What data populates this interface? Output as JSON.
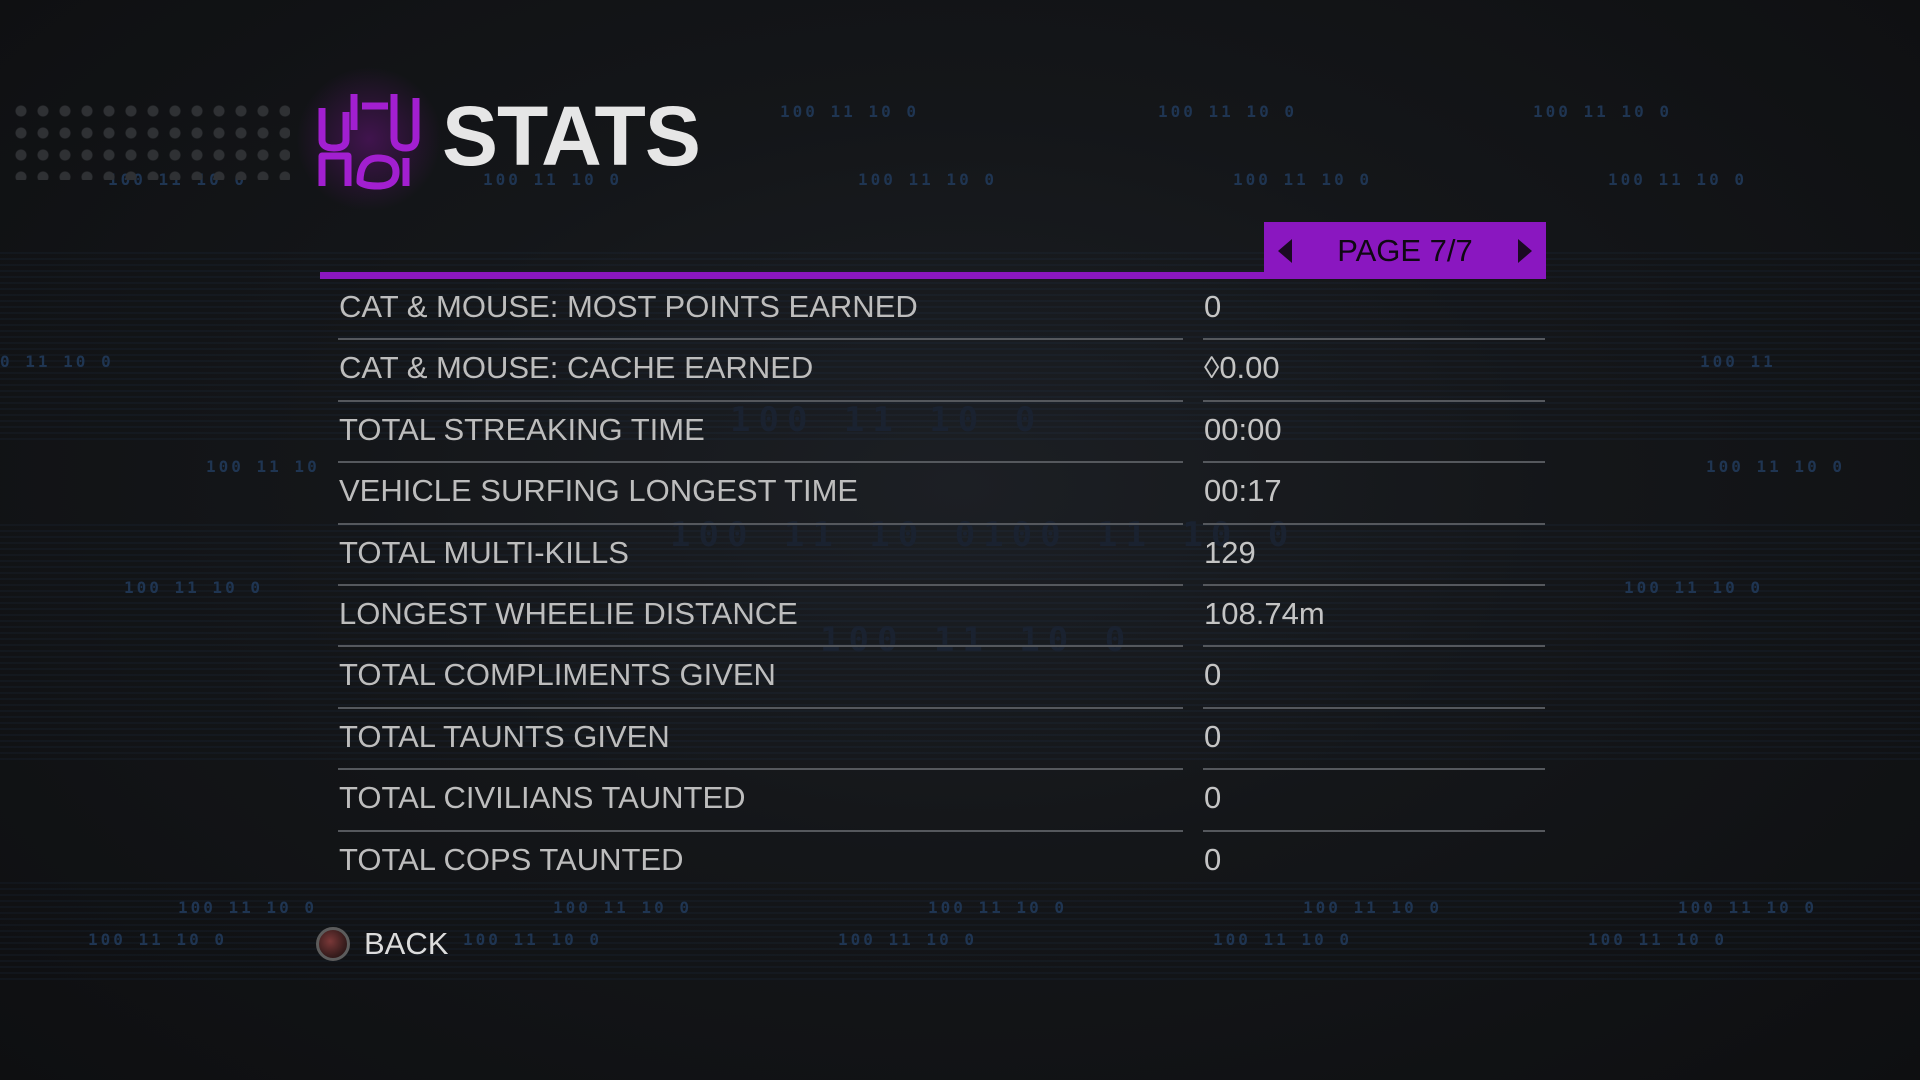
{
  "header": {
    "title": "STATS",
    "logo_icon": "saints-row-logo-icon"
  },
  "pagination": {
    "label": "PAGE 7/7",
    "prev_icon": "arrow-left-icon",
    "next_icon": "arrow-right-icon"
  },
  "stats": [
    {
      "label": "CAT & MOUSE: MOST POINTS EARNED",
      "value": "0"
    },
    {
      "label": "CAT & MOUSE: CACHE EARNED",
      "value": "◊0.00"
    },
    {
      "label": "TOTAL STREAKING TIME",
      "value": "00:00"
    },
    {
      "label": "VEHICLE SURFING LONGEST TIME",
      "value": "00:17"
    },
    {
      "label": "TOTAL MULTI-KILLS",
      "value": "129"
    },
    {
      "label": "LONGEST WHEELIE DISTANCE",
      "value": "108.74m"
    },
    {
      "label": "TOTAL COMPLIMENTS GIVEN",
      "value": "0"
    },
    {
      "label": "TOTAL TAUNTS GIVEN",
      "value": "0"
    },
    {
      "label": "TOTAL CIVILIANS TAUNTED",
      "value": "0"
    },
    {
      "label": "TOTAL COPS TAUNTED",
      "value": "0"
    }
  ],
  "footer": {
    "back_label": "BACK",
    "back_icon": "circle-button-icon"
  },
  "colors": {
    "accent": "#8a17c0",
    "background": "#141619",
    "text": "#bdbdbd"
  }
}
